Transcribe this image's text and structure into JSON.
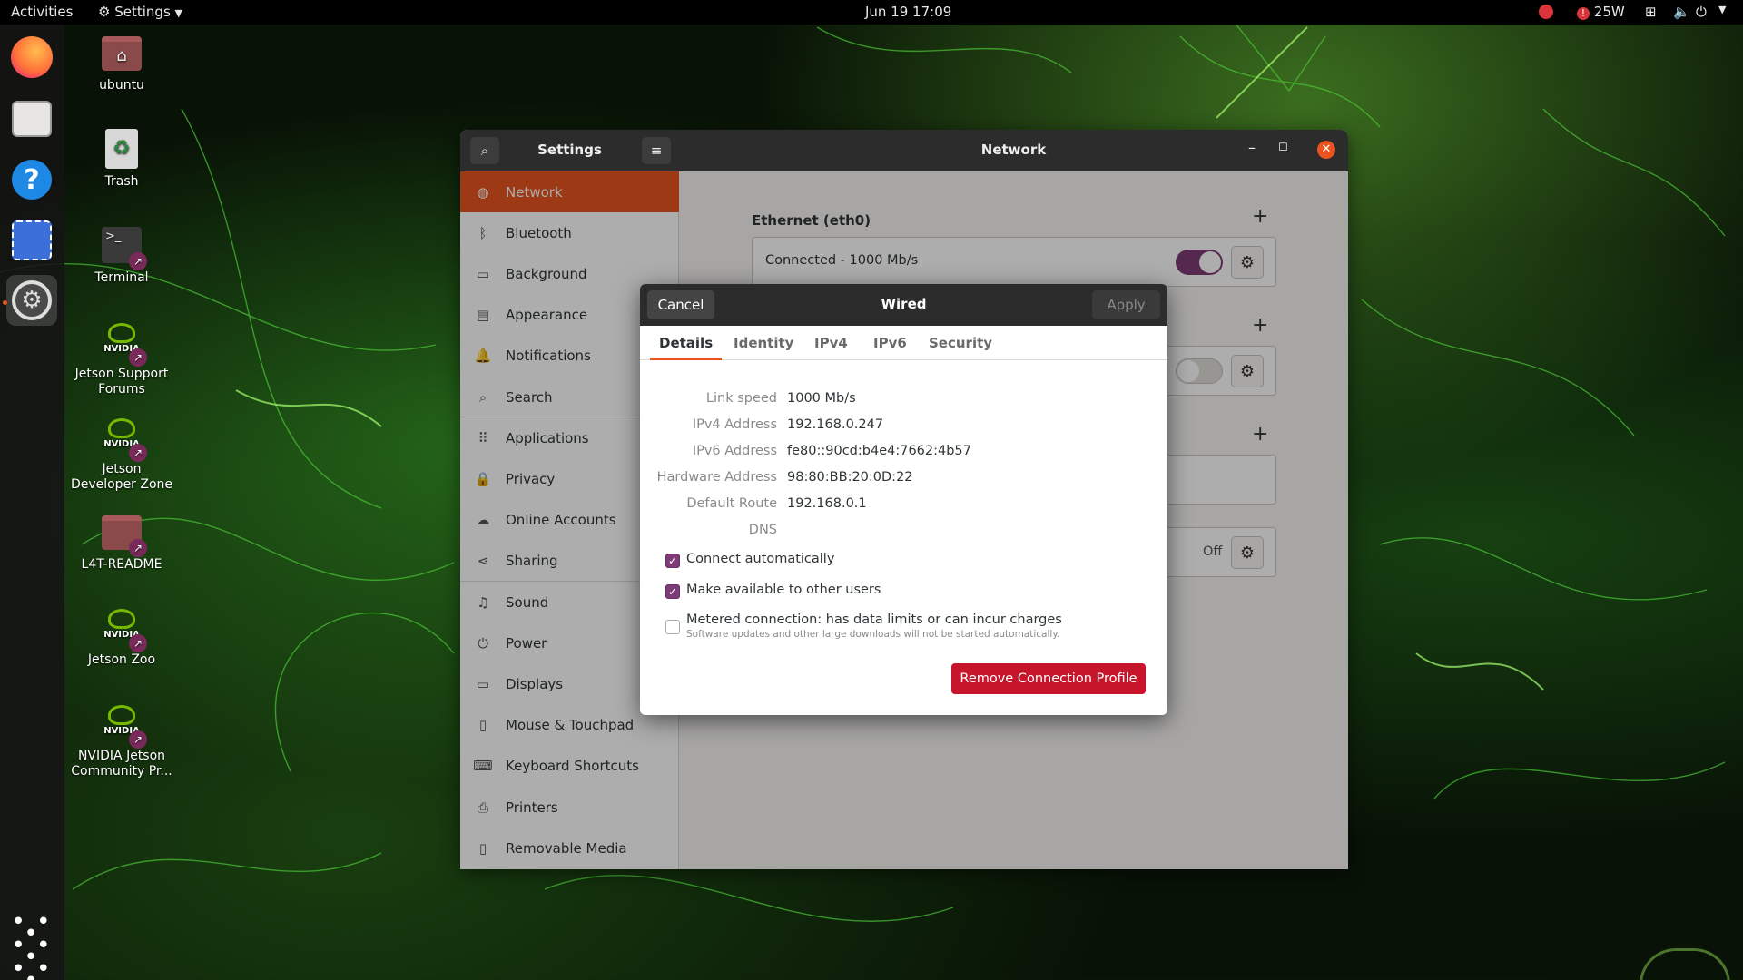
{
  "topbar": {
    "activities": "Activities",
    "app_menu": "Settings",
    "clock": "Jun 19  17:09",
    "power": "25W"
  },
  "desktop_icons": [
    {
      "label": "ubuntu",
      "icon": "home-folder-icon"
    },
    {
      "label": "Trash",
      "icon": "trash-icon"
    },
    {
      "label": "Terminal",
      "icon": "terminal-icon"
    },
    {
      "label": "Jetson Support\nForums",
      "icon": "nvidia-icon"
    },
    {
      "label": "Jetson\nDeveloper Zone",
      "icon": "nvidia-icon"
    },
    {
      "label": "L4T-README",
      "icon": "folder-icon"
    },
    {
      "label": "Jetson Zoo",
      "icon": "nvidia-icon"
    },
    {
      "label": "NVIDIA Jetson\nCommunity Pr...",
      "icon": "nvidia-icon"
    }
  ],
  "nvidia_text": "NVIDIA",
  "settings": {
    "title": "Settings",
    "page_title": "Network",
    "sidebar": [
      {
        "label": "Network",
        "icon": "network-icon",
        "selected": true
      },
      {
        "label": "Bluetooth",
        "icon": "bluetooth-icon"
      },
      {
        "label": "Background",
        "icon": "background-icon"
      },
      {
        "label": "Appearance",
        "icon": "appearance-icon"
      },
      {
        "label": "Notifications",
        "icon": "bell-icon"
      },
      {
        "label": "Search",
        "icon": "search-icon"
      },
      {
        "label": "Applications",
        "icon": "applications-icon"
      },
      {
        "label": "Privacy",
        "icon": "lock-icon"
      },
      {
        "label": "Online Accounts",
        "icon": "cloud-icon"
      },
      {
        "label": "Sharing",
        "icon": "share-icon"
      },
      {
        "label": "Sound",
        "icon": "music-note-icon"
      },
      {
        "label": "Power",
        "icon": "power-icon"
      },
      {
        "label": "Displays",
        "icon": "display-icon"
      },
      {
        "label": "Mouse & Touchpad",
        "icon": "mouse-icon"
      },
      {
        "label": "Keyboard Shortcuts",
        "icon": "keyboard-icon"
      },
      {
        "label": "Printers",
        "icon": "printer-icon"
      },
      {
        "label": "Removable Media",
        "icon": "removable-media-icon"
      }
    ],
    "ethernet": {
      "title": "Ethernet (eth0)",
      "status": "Connected - 1000 Mb/s",
      "toggle_on": true
    },
    "proxy": {
      "status": "Off"
    }
  },
  "dialog": {
    "title": "Wired",
    "cancel": "Cancel",
    "apply": "Apply",
    "tabs": [
      "Details",
      "Identity",
      "IPv4",
      "IPv6",
      "Security"
    ],
    "active_tab": "Details",
    "details": [
      {
        "label": "Link speed",
        "value": "1000 Mb/s"
      },
      {
        "label": "IPv4 Address",
        "value": "192.168.0.247"
      },
      {
        "label": "IPv6 Address",
        "value": "fe80::90cd:b4e4:7662:4b57"
      },
      {
        "label": "Hardware Address",
        "value": "98:80:BB:20:0D:22"
      },
      {
        "label": "Default Route",
        "value": "192.168.0.1"
      },
      {
        "label": "DNS",
        "value": ""
      }
    ],
    "connect_automatically": {
      "label": "Connect automatically",
      "checked": true
    },
    "available_to_others": {
      "label": "Make available to other users",
      "checked": true
    },
    "metered": {
      "label": "Metered connection: has data limits or can incur charges",
      "sublabel": "Software updates and other large downloads will not be started automatically.",
      "checked": false
    },
    "remove": "Remove Connection Profile"
  }
}
